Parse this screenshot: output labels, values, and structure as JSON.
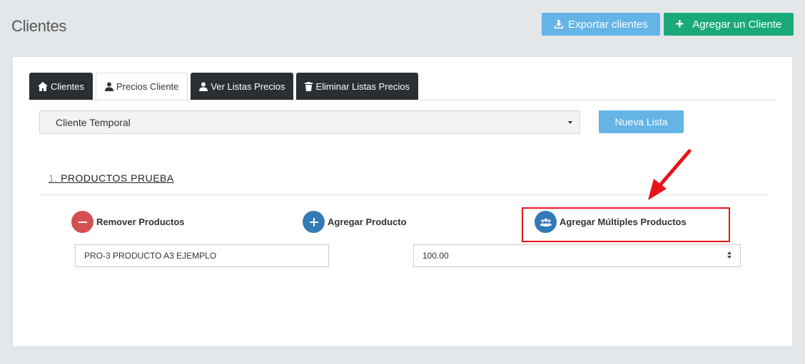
{
  "header": {
    "title": "Clientes",
    "export_label": "Exportar clientes",
    "add_client_label": "Agregar un Cliente"
  },
  "tabs": [
    {
      "label": "Clientes",
      "icon": "home-icon"
    },
    {
      "label": "Precios Cliente",
      "icon": "user-icon",
      "active": true
    },
    {
      "label": "Ver Listas Precios",
      "icon": "user-icon"
    },
    {
      "label": "Eliminar Listas Precios",
      "icon": "trash-icon"
    }
  ],
  "client_select": {
    "value": "Cliente Temporal"
  },
  "new_list_label": "Nueva Lista",
  "section": {
    "number": "1.",
    "title": "PRODUCTOS PRUEBA"
  },
  "actions": {
    "remove_label": "Remover Productos",
    "add_label": "Agregar Producto",
    "add_multiple_label": "Agregar Múltiples Productos"
  },
  "product_row": {
    "product_value": "PRO-3 PRODUCTO A3 EJEMPLO",
    "price_value": "100.00"
  },
  "colors": {
    "primary_light": "#64b4e6",
    "success": "#1aaa7a",
    "danger": "#d2504f",
    "primary": "#337ab7",
    "annotation": "#e8141b"
  }
}
